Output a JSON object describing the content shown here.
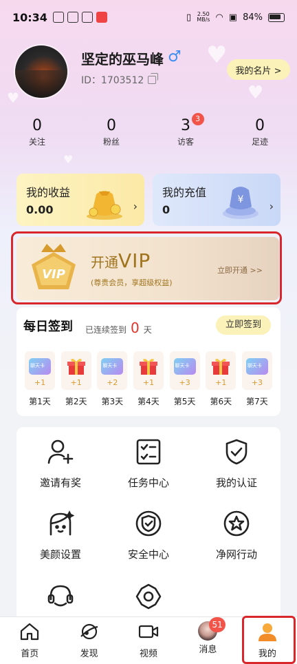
{
  "status_bar": {
    "time": "10:34",
    "speed_top": "2.50",
    "speed_bottom": "MB/s",
    "battery": "84%"
  },
  "profile": {
    "username": "坚定的巫马峰",
    "gender_symbol": "♂",
    "id_label": "ID：1703512",
    "namecard_button": "我的名片 >"
  },
  "stats": [
    {
      "value": "0",
      "label": "关注"
    },
    {
      "value": "0",
      "label": "粉丝"
    },
    {
      "value": "3",
      "label": "访客",
      "badge": "3"
    },
    {
      "value": "0",
      "label": "足迹"
    }
  ],
  "earnings": {
    "title": "我的收益",
    "amount": "0.00"
  },
  "recharge": {
    "title": "我的充值",
    "amount": "0"
  },
  "vip": {
    "badge_text": "VIP",
    "open_prefix": "开通",
    "open_big": "VIP",
    "subtitle": "(尊贵会员，享超级权益)",
    "action": "立即开通 >>"
  },
  "signin": {
    "title": "每日签到",
    "streak_prefix": "已连续签到",
    "streak_count": "0",
    "streak_suffix": "天",
    "button": "立即签到",
    "days": [
      {
        "label": "第1天",
        "reward": "+1",
        "kind": "ticket"
      },
      {
        "label": "第2天",
        "reward": "+1",
        "kind": "gift"
      },
      {
        "label": "第3天",
        "reward": "+2",
        "kind": "ticket"
      },
      {
        "label": "第4天",
        "reward": "+1",
        "kind": "gift"
      },
      {
        "label": "第5天",
        "reward": "+3",
        "kind": "ticket"
      },
      {
        "label": "第6天",
        "reward": "+1",
        "kind": "gift"
      },
      {
        "label": "第7天",
        "reward": "+3",
        "kind": "ticket"
      }
    ]
  },
  "grid": [
    {
      "label": "邀请有奖",
      "icon": "user-plus-icon"
    },
    {
      "label": "任务中心",
      "icon": "task-list-icon"
    },
    {
      "label": "我的认证",
      "icon": "shield-check-icon"
    },
    {
      "label": "美颜设置",
      "icon": "beauty-face-icon"
    },
    {
      "label": "安全中心",
      "icon": "security-shield-icon"
    },
    {
      "label": "净网行动",
      "icon": "star-badge-icon"
    },
    {
      "label": "",
      "icon": "customer-service-icon"
    },
    {
      "label": "",
      "icon": "settings-gear-icon"
    }
  ],
  "nav": [
    {
      "label": "首页",
      "icon": "home-icon"
    },
    {
      "label": "发现",
      "icon": "planet-icon"
    },
    {
      "label": "视频",
      "icon": "video-camera-icon"
    },
    {
      "label": "消息",
      "icon": "message-avatar",
      "badge": "51"
    },
    {
      "label": "我的",
      "icon": "person-icon"
    }
  ],
  "colors": {
    "accent_red": "#d9262b",
    "badge_red": "#f2544a",
    "vip_gold": "#a0741d",
    "male_blue": "#3d8ef0"
  }
}
